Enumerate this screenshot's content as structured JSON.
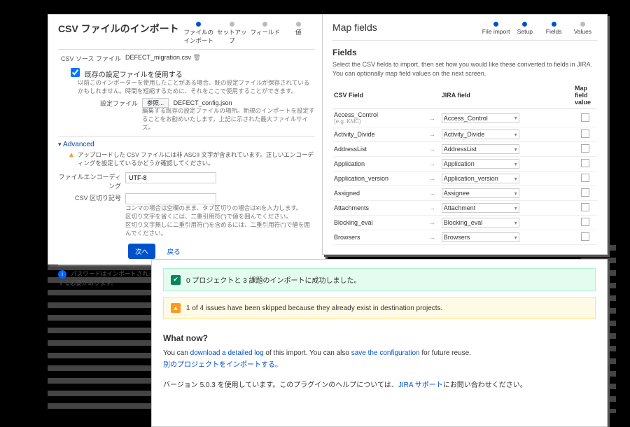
{
  "panelA": {
    "title": "CSV ファイルのインポート",
    "steps": [
      "ファイルのインポート",
      "セットアップ",
      "フィールド",
      "値"
    ],
    "src_label": "CSV ソース ファイル",
    "src_file": "DEFECT_migration.csv",
    "use_existing_cb": "既存の設定ファイルを使用する",
    "use_existing_help": "以前このインポーターを使用したことがある場合、既の設定ファイルが保存されているかもしれません。時間を短縮するために、それをここで使用することができます。",
    "cfg_label": "設定ファイル",
    "cfg_btn": "参照...",
    "cfg_file": "DEFECT_config.json",
    "cfg_help": "編集する既存の設定ファイルの場所。新規のインポートを設定することをお勧めいたします。上記に示された最大ファイルサイズ。",
    "adv": "Advanced",
    "enc_warn": "アップロードした CSV ファイルには非 ASCII 文字が含まれています。正しいエンコーディングを設定しているかどうか確認してください。",
    "enc_label": "ファイルエンコーディング",
    "enc_value": "UTF-8",
    "delim_label": "CSV 区切り記号",
    "delim_value": "",
    "delim_help1": "コンマの場合は空欄のまま、タブ区切りの場合は¥tを入力します。",
    "delim_help2": "区切り文字を省くには、二重引用符(\")で値を囲んでください。",
    "delim_help3": "区切り文字無しに二重引用符(\")を含めるには、二重引用符(\")で値を囲んでください。",
    "btn_next": "次へ",
    "btn_back": "戻る",
    "pw_info": "パスワードはインポートされません。ユーザーは最初のログイン時に新規パスワードを作成する必要があります。"
  },
  "panelB": {
    "title": "Map fields",
    "steps": [
      "File import",
      "Setup",
      "Fields",
      "Values"
    ],
    "h3": "Fields",
    "desc": "Select the CSV fields to import, then set how you would like these converted to fields in JIRA. You can optionally map field values on the next screen.",
    "th_csv": "CSV Field",
    "th_jira": "JIRA field",
    "th_map": "Map field value",
    "rows": [
      {
        "csv": "Access_Control",
        "hint": "(e.g. KMC)",
        "jira": "Access_Control"
      },
      {
        "csv": "Activity_Divide",
        "jira": "Activity_Divide"
      },
      {
        "csv": "AddressList",
        "jira": "AddressList"
      },
      {
        "csv": "Application",
        "jira": "Application"
      },
      {
        "csv": "Application_version",
        "jira": "Application_version"
      },
      {
        "csv": "Assigned",
        "jira": "Assignee"
      },
      {
        "csv": "Attachments",
        "jira": "Attachment"
      },
      {
        "csv": "Blocking_eval",
        "jira": "Blocking_eval"
      },
      {
        "csv": "Browsers",
        "jira": "Browsers"
      }
    ]
  },
  "panelC": {
    "success": "0 プロジェクトと 3 課題のインポートに成功しました。",
    "warn": "1 of 4 issues have been skipped because they already exist in destination projects.",
    "h3": "What now?",
    "l1a": "You can ",
    "l1b": "download a detailed log",
    "l1c": " of this import. You can also ",
    "l1d": "save the configuration",
    "l1e": " for future reuse.",
    "l2": "別のプロジェクトをインポートする。",
    "l3a": "バージョン 5.0.3 を使用しています。このプラグインのヘルプについては、",
    "l3b": "JIRA サポート",
    "l3c": "にお問い合わせください。"
  }
}
